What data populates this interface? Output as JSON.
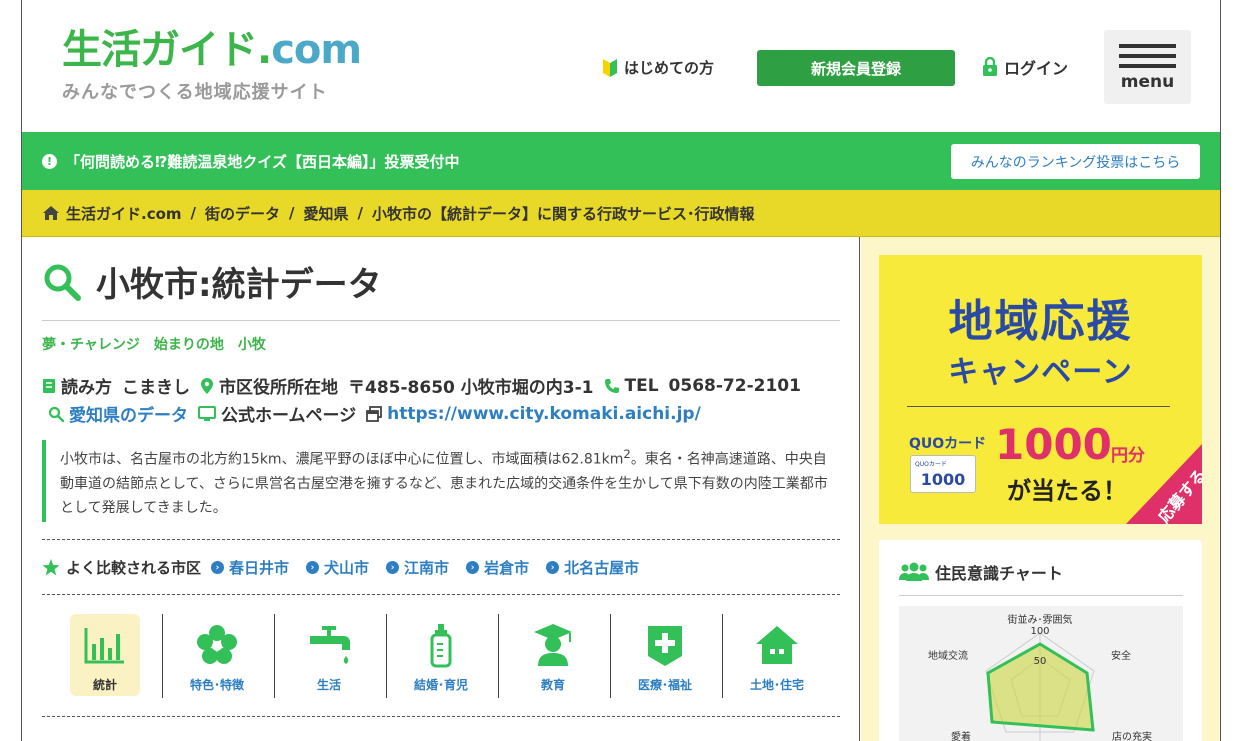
{
  "header": {
    "logo_main": "生活ガイド",
    "logo_dot": ".",
    "logo_com": "com",
    "logo_tagline": "みんなでつくる地域応援サイト",
    "first_time": "はじめての方",
    "register": "新規会員登録",
    "login": "ログイン",
    "menu": "menu"
  },
  "notice": {
    "text": "「何問読める⁉難読温泉地クイズ【西日本編】」投票受付中",
    "icon": "!",
    "ranking_button": "みんなのランキング投票はこちら"
  },
  "breadcrumb": {
    "items": [
      "生活ガイド.com",
      "街のデータ",
      "愛知県",
      "小牧市の【統計データ】に関する行政サービス･行政情報"
    ],
    "separator": "/"
  },
  "page": {
    "title": "小牧市:統計データ",
    "tagline": "夢・チャレンジ　始まりの地　小牧",
    "reading_label": "読み方",
    "reading_value": "こまきし",
    "office_label": "市区役所所在地",
    "office_value": "〒485-8650 小牧市堀の内3-1",
    "tel_label": "TEL",
    "tel_value": "0568-72-2101",
    "pref_link": "愛知県のデータ",
    "homepage_label": "公式ホームページ",
    "homepage_url": "https://www.city.komaki.aichi.jp/",
    "description_a": "小牧市は、名古屋市の北方約15km、濃尾平野のほぼ中心に位置し、市域面積は62.81km",
    "description_sup": "2",
    "description_b": "。東名・名神高速道路、中央自動車道の結節点として、さらに県営名古屋空港を擁するなど、恵まれた広域的交通条件を生かして県下有数の内陸工業都市として発展してきました。"
  },
  "compare": {
    "heading": "よく比較される市区",
    "cities": [
      "春日井市",
      "犬山市",
      "江南市",
      "岩倉市",
      "北名古屋市"
    ]
  },
  "categories": [
    {
      "label": "統計",
      "icon": "bar-chart-icon",
      "active": true
    },
    {
      "label": "特色･特徴",
      "icon": "flower-icon",
      "active": false
    },
    {
      "label": "生活",
      "icon": "faucet-icon",
      "active": false
    },
    {
      "label": "結婚･育児",
      "icon": "baby-bottle-icon",
      "active": false
    },
    {
      "label": "教育",
      "icon": "graduate-icon",
      "active": false
    },
    {
      "label": "医療･福祉",
      "icon": "medical-cross-icon",
      "active": false
    },
    {
      "label": "土地･住宅",
      "icon": "house-icon",
      "active": false
    }
  ],
  "sidebar": {
    "banner": {
      "title": "地域応援",
      "subtitle": "キャンペーン",
      "quo_label": "QUOカード",
      "card_small": "QUOカード",
      "card_value": "1000",
      "amount": "1000",
      "amount_unit": "円分",
      "win": "が当たる！",
      "apply": "応募する"
    },
    "chart_panel": {
      "title": "住民意識チャート",
      "axes": [
        "街並み･雰囲気",
        "安全",
        "店の充実",
        "愛着",
        "地域交流"
      ],
      "ticks": [
        "100",
        "50"
      ]
    }
  },
  "colors": {
    "green": "#34c059",
    "yellow": "#e8d928",
    "link_blue": "#2e7fc2",
    "side_bg": "#fdf6c9"
  }
}
